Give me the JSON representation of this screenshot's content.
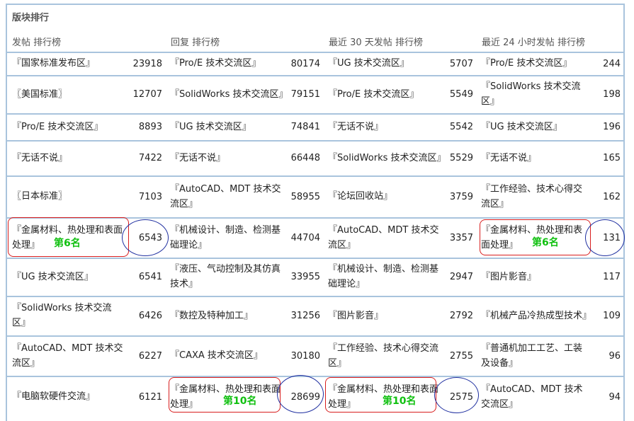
{
  "section": {
    "title": "版块排行"
  },
  "columns": [
    {
      "header": "发帖 排行榜"
    },
    {
      "header": "回复 排行榜"
    },
    {
      "header": "最近 30 天发帖 排行榜"
    },
    {
      "header": "最近 24 小时发帖 排行榜"
    }
  ],
  "rows": [
    [
      {
        "name": "『国家标准发布区』",
        "count": "23918"
      },
      {
        "name": "『Pro/E 技术交流区』",
        "count": "80174"
      },
      {
        "name": "『UG 技术交流区』",
        "count": "5707"
      },
      {
        "name": "『Pro/E 技术交流区』",
        "count": "244"
      }
    ],
    [
      {
        "name": "〖美国标准〗",
        "count": "12707"
      },
      {
        "name": "『SolidWorks 技术交流区』",
        "count": "79151"
      },
      {
        "name": "『Pro/E 技术交流区』",
        "count": "5549"
      },
      {
        "name": "『SolidWorks 技术交流区』",
        "count": "198"
      }
    ],
    [
      {
        "name": "『Pro/E 技术交流区』",
        "count": "8893"
      },
      {
        "name": "『UG 技术交流区』",
        "count": "74841"
      },
      {
        "name": "『无话不说』",
        "count": "5542"
      },
      {
        "name": "『UG 技术交流区』",
        "count": "196"
      }
    ],
    [
      {
        "name": "『无话不说』",
        "count": "7422"
      },
      {
        "name": "『无话不说』",
        "count": "66448"
      },
      {
        "name": "『SolidWorks 技术交流区』",
        "count": "5529"
      },
      {
        "name": "『无话不说』",
        "count": "165"
      }
    ],
    [
      {
        "name": "〖日本标准〗",
        "count": "7103"
      },
      {
        "name": "『AutoCAD、MDT 技术交流区』",
        "count": "58955"
      },
      {
        "name": "『论坛回收站』",
        "count": "3759"
      },
      {
        "name": "『工作经验、技术心得交流区』",
        "count": "162"
      }
    ],
    [
      {
        "name": "『金属材料、热处理和表面处理』",
        "count": "6543"
      },
      {
        "name": "『机械设计、制造、检测基础理论』",
        "count": "44704"
      },
      {
        "name": "『AutoCAD、MDT 技术交流区』",
        "count": "3357"
      },
      {
        "name": "『金属材料、热处理和表面处理』",
        "count": "131"
      }
    ],
    [
      {
        "name": "『UG 技术交流区』",
        "count": "6541"
      },
      {
        "name": "『液压、气动控制及其仿真技术』",
        "count": "33955"
      },
      {
        "name": "『机械设计、制造、检测基础理论』",
        "count": "2947"
      },
      {
        "name": "『图片影音』",
        "count": "117"
      }
    ],
    [
      {
        "name": "『SolidWorks 技术交流区』",
        "count": "6426"
      },
      {
        "name": "『数控及特种加工』",
        "count": "31256"
      },
      {
        "name": "『图片影音』",
        "count": "2792"
      },
      {
        "name": "『机械产品冷热成型技术』",
        "count": "109"
      }
    ],
    [
      {
        "name": "『AutoCAD、MDT 技术交流区』",
        "count": "6227"
      },
      {
        "name": "『CAXA 技术交流区』",
        "count": "30180"
      },
      {
        "name": "『工作经验、技术心得交流区』",
        "count": "2755"
      },
      {
        "name": "『普通机加工工艺、工装及设备』",
        "count": "96"
      }
    ],
    [
      {
        "name": "『电脑软硬件交流』",
        "count": "6121"
      },
      {
        "name": "『金属材料、热处理和表面处理』",
        "count": "28699"
      },
      {
        "name": "『金属材料、热处理和表面处理』",
        "count": "2575"
      },
      {
        "name": "『AutoCAD、MDT 技术交流区』",
        "count": "94"
      }
    ]
  ],
  "annotations": {
    "rank6": "第6名",
    "rank10": "第10名"
  },
  "colors": {
    "border": "#a9c4dd",
    "highlight_box": "#d81e1e",
    "count_oval": "#1f2fa0",
    "rank_text": "#10c010"
  }
}
